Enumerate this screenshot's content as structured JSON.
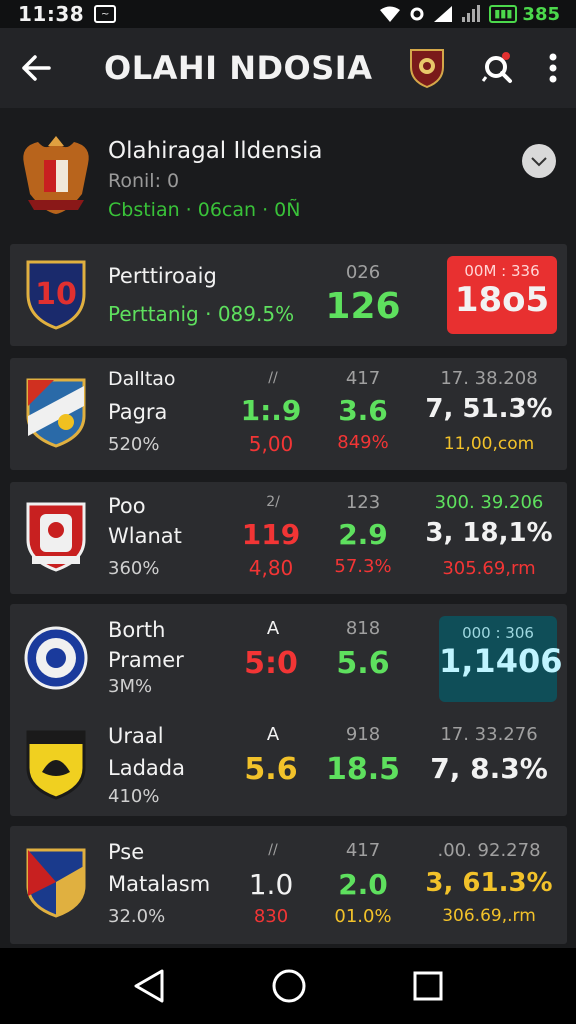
{
  "status_bar": {
    "time": "11:38",
    "battery_text": "385"
  },
  "app_bar": {
    "title": "OLAHI NDOSIA"
  },
  "league": {
    "name": "Olahiragal Ildensia",
    "meta": "Ronil: 0",
    "status": "Cbstian · 06can · 0Ñ"
  },
  "featured": {
    "name": "Perttiroaig",
    "sub": "Perttanig · 089.5%",
    "col_label": "026",
    "value": "126",
    "box_top": "00M : 336",
    "box_value": "18o5"
  },
  "teams": [
    {
      "line1": "Dalltao",
      "line2": "Pagra",
      "line3": "520%",
      "mid_label": "//",
      "mid_value": "1:.9",
      "mid_sub": "5,00",
      "col_label": "417",
      "col_value": "3.6",
      "col_sub": "849%",
      "right_label": "17. 38.208",
      "right_value": "7, 51.3%",
      "right_sub": "11,00,com"
    },
    {
      "line1": "Poo",
      "line2": "Wlanat",
      "line3": "360%",
      "mid_label": "2/",
      "mid_value": "119",
      "mid_sub": "4,80",
      "col_label": "123",
      "col_value": "2.9",
      "col_sub": "57.3%",
      "right_label": "300. 39.206",
      "right_value": "3, 18,1%",
      "right_sub": "305.69,rm"
    },
    {
      "line1": "Borth",
      "line2": "Pramer",
      "line3": "3M%",
      "mid_label": "A",
      "mid_value": "5:0",
      "col_label": "818",
      "col_value": "5.6",
      "box_top": "000 : 306",
      "box_value": "1,1406"
    },
    {
      "line1": "Uraal",
      "line2": "Ladada",
      "line3": "410%",
      "mid_label": "A",
      "mid_value": "5.6",
      "col_label": "918",
      "col_value": "18.5",
      "right_label": "17. 33.276",
      "right_value": "7, 8.3%"
    },
    {
      "line1": "Pse",
      "line2": "Matalasm",
      "line3": "32.0%",
      "mid_label": "//",
      "mid_value": "1.0",
      "mid_sub": "830",
      "col_label": "417",
      "col_value": "2.0",
      "col_sub": "01.0%",
      "right_label": ".00. 92.278",
      "right_value": "3, 61.3%",
      "right_sub": "306.69,.rm"
    }
  ],
  "colors": {
    "green": "#5ee05e",
    "red": "#f23535",
    "yellow": "#f2c22a",
    "teal": "#0f4e58"
  },
  "icons": [
    "back-arrow-icon",
    "shield-badge-icon",
    "search-icon",
    "more-vert-icon",
    "collapse-icon",
    "nav-back-icon",
    "nav-home-icon",
    "nav-recents-icon"
  ]
}
